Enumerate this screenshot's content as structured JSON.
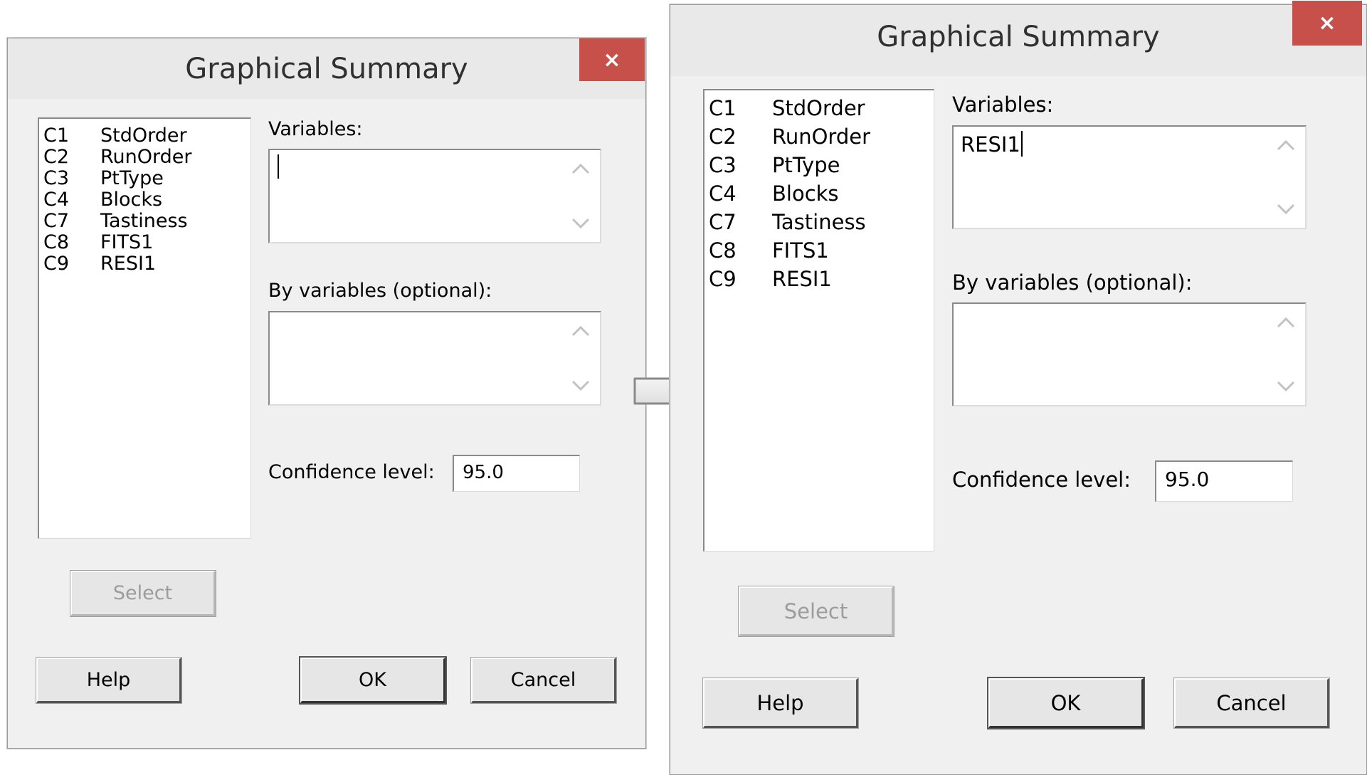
{
  "before": {
    "title": "Graphical Summary",
    "close_label": "×",
    "columns": [
      {
        "code": "C1",
        "name": "StdOrder"
      },
      {
        "code": "C2",
        "name": "RunOrder"
      },
      {
        "code": "C3",
        "name": "PtType"
      },
      {
        "code": "C4",
        "name": "Blocks"
      },
      {
        "code": "C7",
        "name": "Tastiness"
      },
      {
        "code": "C8",
        "name": "FITS1"
      },
      {
        "code": "C9",
        "name": "RESI1"
      }
    ],
    "variables_label": "Variables:",
    "variables_value": "",
    "by_variables_label": "By variables (optional):",
    "by_variables_value": "",
    "confidence_label": "Confidence level:",
    "confidence_value": "95.0",
    "select_label": "Select",
    "help_label": "Help",
    "ok_label": "OK",
    "cancel_label": "Cancel"
  },
  "after": {
    "title": "Graphical Summary",
    "close_label": "×",
    "columns": [
      {
        "code": "C1",
        "name": "StdOrder"
      },
      {
        "code": "C2",
        "name": "RunOrder"
      },
      {
        "code": "C3",
        "name": "PtType"
      },
      {
        "code": "C4",
        "name": "Blocks"
      },
      {
        "code": "C7",
        "name": "Tastiness"
      },
      {
        "code": "C8",
        "name": "FITS1"
      },
      {
        "code": "C9",
        "name": "RESI1"
      }
    ],
    "variables_label": "Variables:",
    "variables_value": "RESI1",
    "by_variables_label": "By variables (optional):",
    "by_variables_value": "",
    "confidence_label": "Confidence level:",
    "confidence_value": "95.0",
    "select_label": "Select",
    "help_label": "Help",
    "ok_label": "OK",
    "cancel_label": "Cancel"
  },
  "colors": {
    "dialog_background": "#f0f0f0",
    "close_button": "#c7504a",
    "disabled_text": "#9c9c9c"
  }
}
